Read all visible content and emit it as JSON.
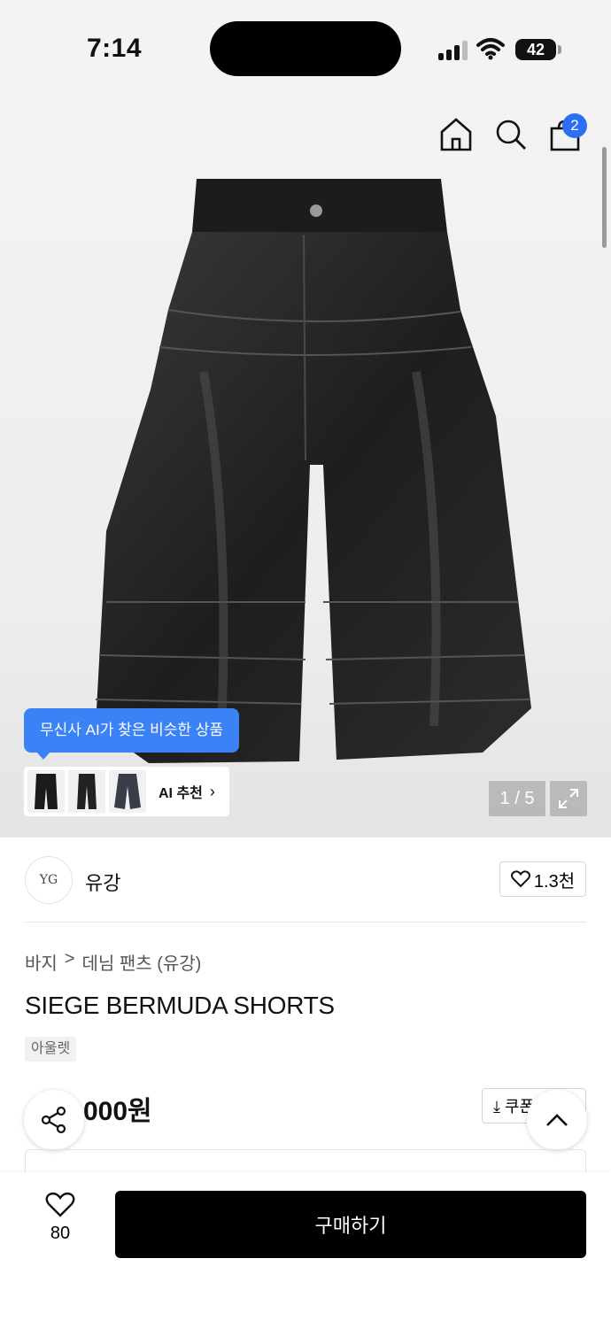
{
  "status_bar": {
    "time": "7:14",
    "battery": "42"
  },
  "header": {
    "cart_count": "2"
  },
  "gallery": {
    "ai_tooltip": "무신사 AI가 찾은 비슷한 상품",
    "ai_label": "AI 추천",
    "page_indicator": "1 / 5"
  },
  "brand": {
    "logo_text": "YG",
    "name": "유강",
    "likes": "1.3천"
  },
  "breadcrumb": {
    "category": "바지",
    "separator": ">",
    "subcategory": "데님 팬츠 (유강)"
  },
  "product": {
    "title": "SIEGE BERMUDA SHORTS",
    "tag": "아울렛",
    "price": "000원",
    "coupon_label": "쿠폰"
  },
  "bottom_bar": {
    "wish_count": "80",
    "buy_label": "구매하기"
  },
  "colors": {
    "accent_blue": "#3b82f6",
    "badge_blue": "#2b6ff2",
    "buy_button": "#000000"
  }
}
